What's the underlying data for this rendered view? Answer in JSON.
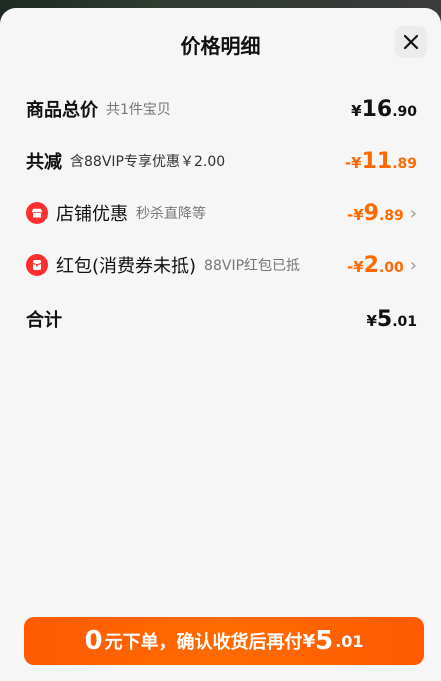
{
  "sheet": {
    "title": "价格明细",
    "close": "×"
  },
  "rows": {
    "total": {
      "label": "商品总价",
      "sub": "共1件宝贝",
      "amount": {
        "currency": "¥",
        "int": "16",
        "dec": ".90"
      }
    },
    "discount": {
      "label": "共减",
      "sub": "含88VIP专享优惠￥2.00",
      "amount": {
        "prefix": "-",
        "currency": "¥",
        "int": "11",
        "dec": ".89"
      }
    },
    "shop": {
      "label": "店铺优惠",
      "sub": "秒杀直降等",
      "amount": {
        "prefix": "-",
        "currency": "¥",
        "int": "9",
        "dec": ".89"
      },
      "chevron": "›"
    },
    "redpacket": {
      "label": "红包(消费券未抵)",
      "sub": "88VIP红包已抵",
      "amount": {
        "prefix": "-",
        "currency": "¥",
        "int": "2",
        "dec": ".00"
      },
      "chevron": "›"
    },
    "sum": {
      "label": "合计",
      "amount": {
        "currency": "¥",
        "int": "5",
        "dec": ".01"
      }
    }
  },
  "cta": {
    "zero": "0",
    "text1": "元下单，确认收货后再付",
    "currency": "¥",
    "int": "5",
    "dec": ".01"
  },
  "colors": {
    "accent": "#ff6a00",
    "badge": "#ff2f2f"
  }
}
